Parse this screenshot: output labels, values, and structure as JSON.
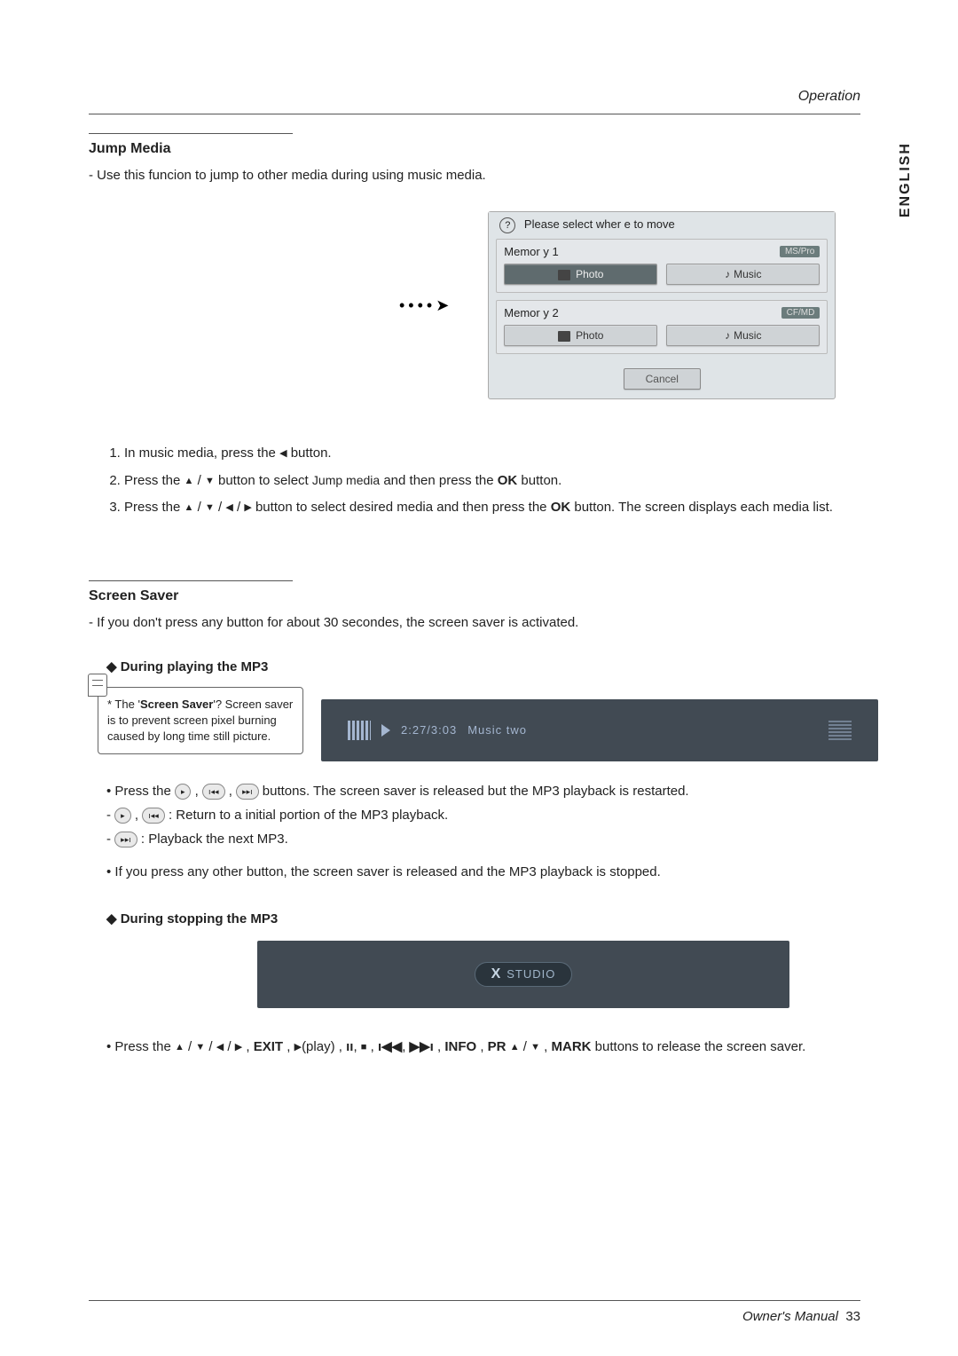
{
  "page": {
    "header_section": "Operation",
    "language_tab": "ENGLISH",
    "footer": "Owner's Manual",
    "page_number": "33"
  },
  "jump_media": {
    "title": "Jump Media",
    "desc": "-  Use this funcion to jump to other media during using music media.",
    "arrow": "••••➤",
    "dialog": {
      "prompt": "Please select wher e to move",
      "mem1": {
        "name": "Memor y 1",
        "tag": "MS/Pro",
        "photo": "Photo",
        "music": "Music"
      },
      "mem2": {
        "name": "Memor y 2",
        "tag": "CF/MD",
        "photo": "Photo",
        "music": "Music"
      },
      "cancel": "Cancel"
    },
    "steps": {
      "s1a": "In music media, press the ",
      "s1b": " button.",
      "s2a": "Press the ",
      "s2b": " button to select ",
      "s2c": "Jump media",
      "s2d": "    and then press the ",
      "s2e": "OK",
      "s2f": " button.",
      "s3a": "Press the ",
      "s3b": " button to select desired media and then press the ",
      "s3c": "OK",
      "s3d": " button. The screen displays each media list."
    }
  },
  "screen_saver": {
    "title": "Screen Saver",
    "desc": "-  If you don't press any button for about 30 secondes, the screen saver is activated.",
    "sub_play": "During playing the MP3",
    "callout": {
      "q": "* The '",
      "q_bold": "Screen Saver",
      "q2": "'? Screen saver is to prevent screen pixel burning caused by long time still picture."
    },
    "bar_time": "2:27/3:03",
    "bar_track": "Music two",
    "b1a": "• Press the ",
    "b1b": " buttons. The screen saver is released but the MP3 playback is restarted.",
    "b2a": "- ",
    "b2b": "  :  Return to a initial portion of the MP3 playback.",
    "b3a": "- ",
    "b3b": "  :  Playback the next MP3.",
    "b4": "• If you press any other button, the screen saver is released and the MP3 playback is stopped.",
    "sub_stop": "During stopping the MP3",
    "logo": "STUDIO",
    "final_a": "• Press the ",
    "final_b": ", ",
    "final_exit": "EXIT",
    "final_c": ", ",
    "final_play": "(play)",
    "final_d": ", ",
    "final_info": "INFO",
    "final_e": ", ",
    "final_pr": "PR",
    "final_f": ", ",
    "final_mark": "MARK",
    "final_g": " buttons to release the screen saver."
  }
}
